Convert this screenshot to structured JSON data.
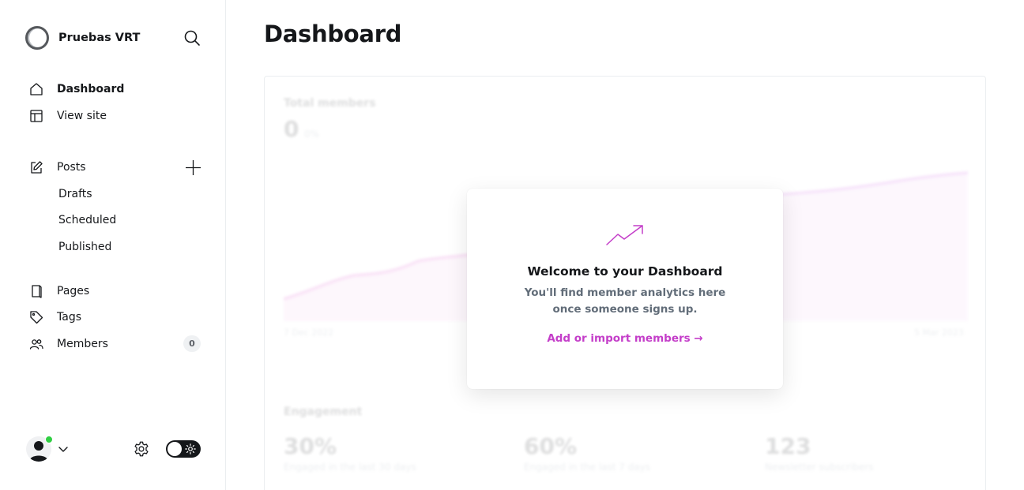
{
  "sidebar": {
    "site_name": "Pruebas VRT",
    "nav": {
      "dashboard": "Dashboard",
      "view_site": "View site",
      "posts": "Posts",
      "drafts": "Drafts",
      "scheduled": "Scheduled",
      "published": "Published",
      "pages": "Pages",
      "tags": "Tags",
      "members": "Members",
      "members_count": "0"
    }
  },
  "main": {
    "title": "Dashboard",
    "chart_background": {
      "total_members_label": "Total members",
      "total_members_value": "0",
      "total_members_unit": "0%",
      "start_date": "7 Dec 2022",
      "end_date": "5 Mar 2023",
      "engagement_label": "Engagement",
      "stats": [
        {
          "value": "30%",
          "caption": "Engaged in the last 30 days"
        },
        {
          "value": "60%",
          "caption": "Engaged in the last 7 days"
        },
        {
          "value": "123",
          "caption": "Newsletter subscribers"
        }
      ]
    },
    "welcome": {
      "title": "Welcome to your Dashboard",
      "text": "You'll find member analytics here once someone signs up.",
      "link": "Add or import members →"
    }
  },
  "colors": {
    "accent": "#c43ec9",
    "online": "#30cf43",
    "text": "#15171a"
  }
}
